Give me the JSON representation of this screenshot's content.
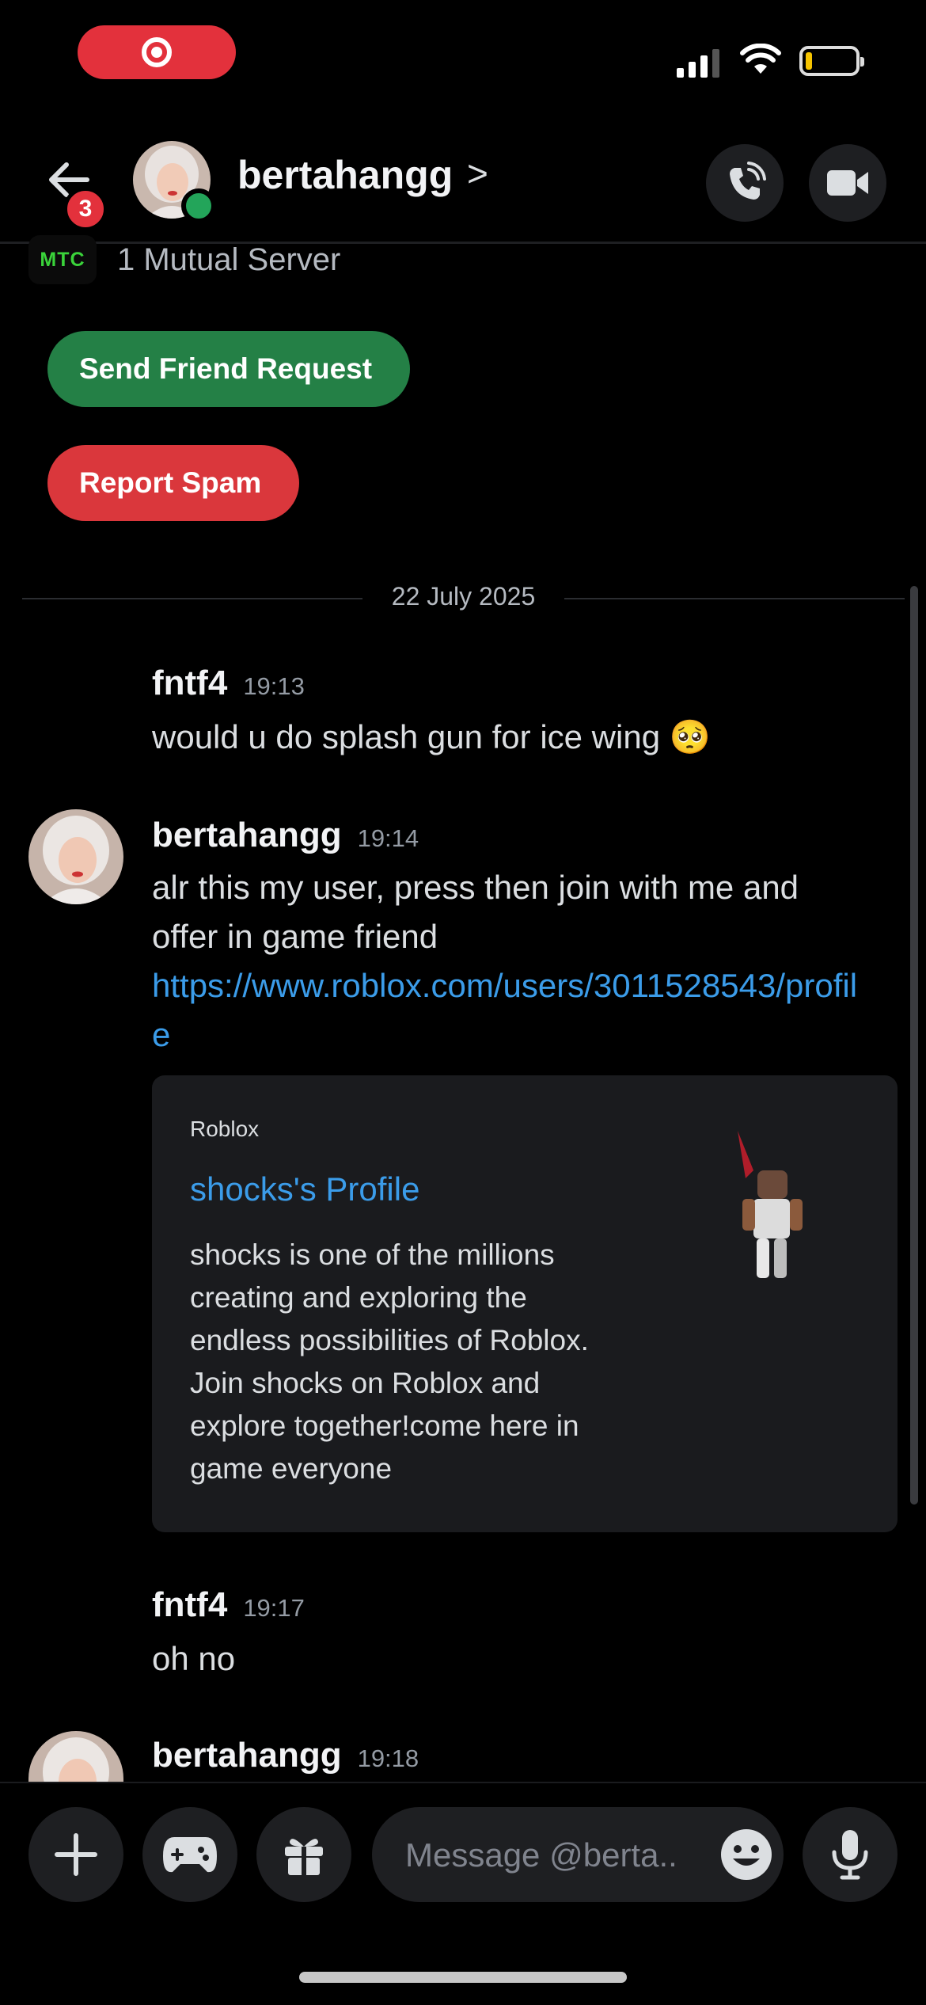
{
  "header": {
    "unread_count": "3",
    "username": "bertahangg",
    "chevron": ">",
    "icons": {
      "back": "arrow-left-icon",
      "call": "phone-call-icon",
      "video": "video-camera-icon"
    }
  },
  "status_bar": {
    "recording": true,
    "icons": [
      "screen-record-icon",
      "signal-icon",
      "wifi-icon",
      "battery-icon"
    ]
  },
  "intro": {
    "server_badge": "MTC",
    "mutual_servers": "1 Mutual Server",
    "send_friend_request": "Send Friend Request",
    "report_spam": "Report Spam"
  },
  "date_divider": "22 July 2025",
  "messages": [
    {
      "author": "fntf4",
      "time": "19:13",
      "text": "would u do splash gun for ice wing 🥺"
    },
    {
      "author": "bertahangg",
      "time": "19:14",
      "text": "alr this my user, press then join with me and offer in game friend",
      "link": "https://www.roblox.com/users/3011528543/profile"
    },
    {
      "author": "fntf4",
      "time": "19:17",
      "text": "oh no"
    },
    {
      "author": "bertahangg",
      "time": "19:18"
    }
  ],
  "embed": {
    "provider": "Roblox",
    "title": "shocks's Profile",
    "description": "shocks is one of the millions creating and exploring the endless possibilities of Roblox. Join shocks on Roblox and explore together!come here in game everyone"
  },
  "composer": {
    "placeholder": "Message @berta..",
    "icons": [
      "plus-icon",
      "gamepad-icon",
      "gift-icon",
      "emoji-icon",
      "microphone-icon"
    ]
  },
  "colors": {
    "accent_link": "#3b9ce9",
    "green_button": "#248046",
    "red_button": "#da373c",
    "online": "#23a55a"
  }
}
